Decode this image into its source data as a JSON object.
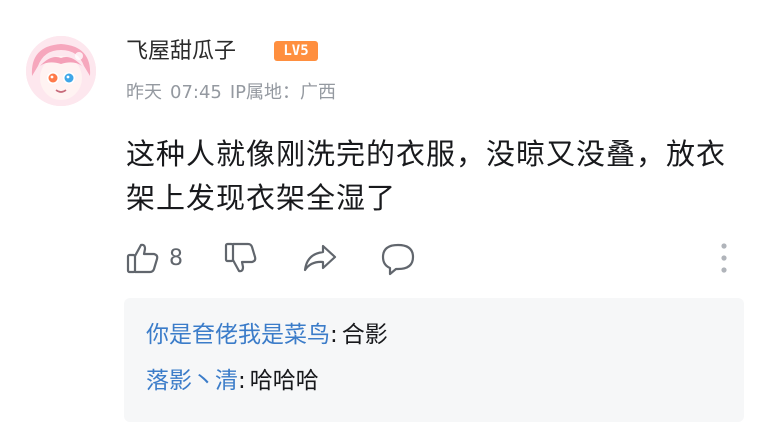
{
  "user": {
    "name": "飞屋甜瓜子",
    "level": "LV5"
  },
  "meta": {
    "date": "昨天",
    "time": "07:45",
    "ip_location": "IP属地：广西"
  },
  "comment": {
    "text": "这种人就像刚洗完的衣服，没晾又没叠，放衣架上发现衣架全湿了"
  },
  "actions": {
    "like_count": "8",
    "icons": [
      "thumbs-up-icon",
      "thumbs-down-icon",
      "share-icon",
      "reply-bubble-icon",
      "more-vertical-icon"
    ]
  },
  "replies": [
    {
      "name": "你是奆佬我是菜鸟",
      "separator": ":",
      "text": "合影"
    },
    {
      "name": "落影丶清",
      "separator": ":",
      "text": "哈哈哈"
    }
  ],
  "colors": {
    "level_badge": "#ff8f3f",
    "reply_name": "#3b7cc9",
    "meta_text": "#9499a0",
    "reply_bg": "#f6f7f8"
  }
}
